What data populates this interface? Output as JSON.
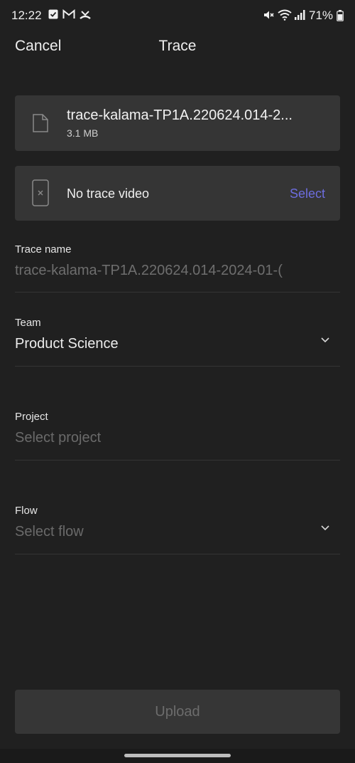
{
  "status_bar": {
    "time": "12:22",
    "battery": "71%"
  },
  "header": {
    "cancel_label": "Cancel",
    "title": "Trace"
  },
  "file_card": {
    "name": "trace-kalama-TP1A.220624.014-2...",
    "size": "3.1 MB"
  },
  "video_card": {
    "label": "No trace video",
    "action_label": "Select"
  },
  "fields": {
    "trace_name": {
      "label": "Trace name",
      "value": "trace-kalama-TP1A.220624.014-2024-01-("
    },
    "team": {
      "label": "Team",
      "value": "Product Science"
    },
    "project": {
      "label": "Project",
      "placeholder": "Select project"
    },
    "flow": {
      "label": "Flow",
      "placeholder": "Select flow"
    }
  },
  "upload_label": "Upload",
  "colors": {
    "background": "#202020",
    "card": "#353535",
    "accent": "#6d6ddf",
    "placeholder": "#6a6a6a"
  }
}
